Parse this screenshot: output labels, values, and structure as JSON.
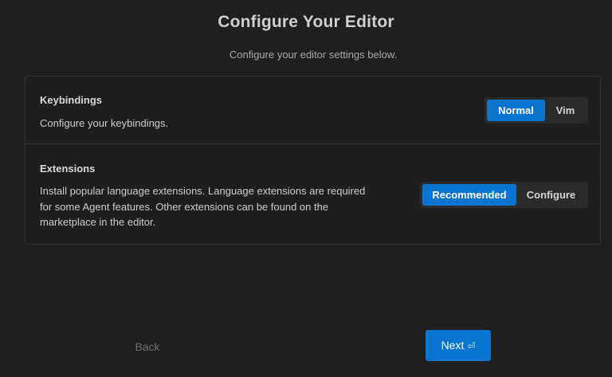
{
  "header": {
    "title": "Configure Your Editor",
    "subtitle": "Configure your editor settings below."
  },
  "settings": {
    "keybindings": {
      "label": "Keybindings",
      "description": "Configure your keybindings.",
      "options": [
        "Normal",
        "Vim"
      ],
      "selected": "Normal"
    },
    "extensions": {
      "label": "Extensions",
      "description": "Install popular language extensions. Language extensions are required for some Agent features. Other extensions can be found on the marketplace in the editor.",
      "options": [
        "Recommended",
        "Configure"
      ],
      "selected": "Recommended"
    }
  },
  "footer": {
    "back_label": "Back",
    "next_label": "Next",
    "next_icon": "enter-key-icon",
    "next_icon_glyph": "⏎"
  },
  "colors": {
    "accent": "#0a74d1",
    "background": "#1f1f1f"
  }
}
